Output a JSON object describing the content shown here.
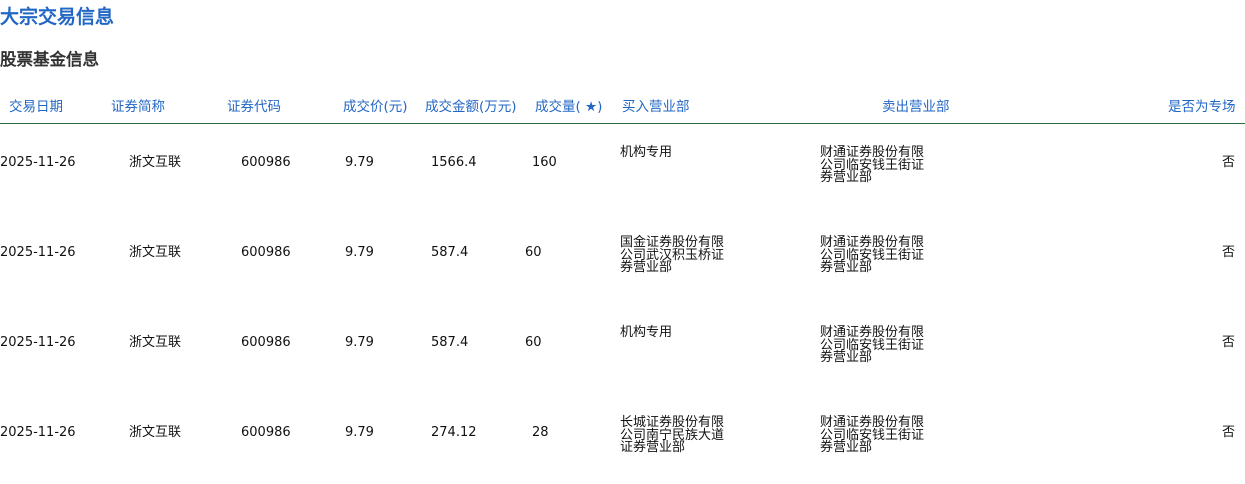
{
  "page_title": "大宗交易信息",
  "section_title": "股票基金信息",
  "table": {
    "headers": {
      "trade_date": "交易日期",
      "security_name": "证券简称",
      "security_code": "证券代码",
      "price": "成交价(元)",
      "amount": "成交金额(万元)",
      "volume": "成交量( ★)",
      "buyer": "买入营业部",
      "seller": "卖出营业部",
      "special": "是否为专场"
    },
    "rows": [
      {
        "trade_date": "2025-11-26",
        "security_name": "浙文互联",
        "security_code": "600986",
        "price": "9.79",
        "amount": "1566.4",
        "volume": "160",
        "buyer": "机构专用",
        "seller": "财通证券股份有限公司临安钱王街证券营业部",
        "special": "否"
      },
      {
        "trade_date": "2025-11-26",
        "security_name": "浙文互联",
        "security_code": "600986",
        "price": "9.79",
        "amount": "587.4",
        "volume": "60",
        "buyer": "国金证券股份有限公司武汉积玉桥证券营业部",
        "seller": "财通证券股份有限公司临安钱王街证券营业部",
        "special": "否"
      },
      {
        "trade_date": "2025-11-26",
        "security_name": "浙文互联",
        "security_code": "600986",
        "price": "9.79",
        "amount": "587.4",
        "volume": "60",
        "buyer": "机构专用",
        "seller": "财通证券股份有限公司临安钱王街证券营业部",
        "special": "否"
      },
      {
        "trade_date": "2025-11-26",
        "security_name": "浙文互联",
        "security_code": "600986",
        "price": "9.79",
        "amount": "274.12",
        "volume": "28",
        "buyer": "长城证券股份有限公司南宁民族大道证券营业部",
        "seller": "财通证券股份有限公司临安钱王街证券营业部",
        "special": "否"
      }
    ]
  },
  "colors": {
    "title": "#2367c5",
    "header_text": "#2367c5",
    "header_rule": "#2e6b3e",
    "section_title": "#333333"
  }
}
